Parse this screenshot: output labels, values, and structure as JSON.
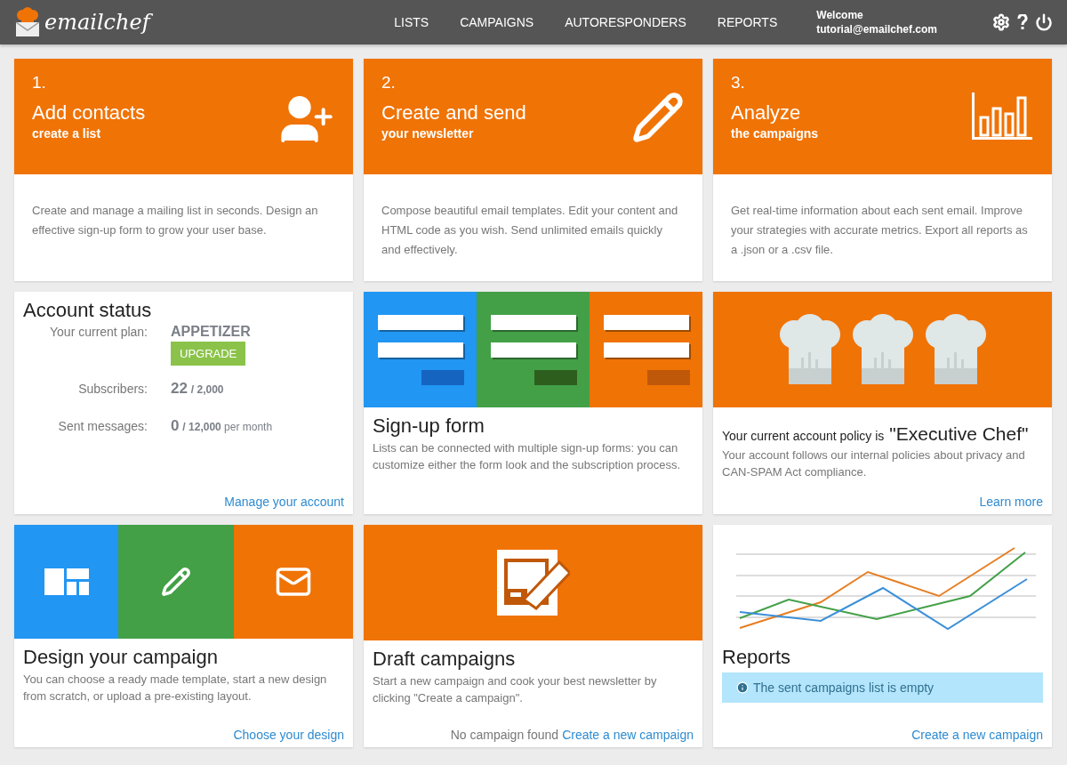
{
  "header": {
    "brand": "emailchef",
    "menu": [
      {
        "label": "LISTS"
      },
      {
        "label": "CAMPAIGNS"
      },
      {
        "label": "AUTORESPONDERS"
      },
      {
        "label": "REPORTS"
      }
    ],
    "welcome": "Welcome",
    "email": "tutorial@emailchef.com"
  },
  "steps": [
    {
      "number": "1.",
      "title": "Add contacts",
      "subtitle": "create a list",
      "description": "Create and manage a mailing list in seconds. Design an effective sign-up form to grow your user base."
    },
    {
      "number": "2.",
      "title": "Create and send",
      "subtitle": "your newsletter",
      "description": "Compose beautiful email templates. Edit your content and HTML code as you wish. Send unlimited emails quickly and effectively."
    },
    {
      "number": "3.",
      "title": "Analyze",
      "subtitle": "the campaigns",
      "description": "Get real-time information about each sent email. Improve your strategies with accurate metrics. Export all reports as a .json or a .csv file."
    }
  ],
  "account": {
    "title": "Account status",
    "plan_label": "Your current plan:",
    "plan": "APPETIZER",
    "upgrade": "UPGRADE",
    "stats": [
      {
        "label": "Subscribers:",
        "value": "22",
        "total": "/ 2,000"
      },
      {
        "label": "Sent messages:",
        "value": "0",
        "total": "/ 12,000",
        "suffix": "per month"
      }
    ],
    "link": "Manage your account"
  },
  "signup": {
    "title": "Sign-up form",
    "description": "Lists can be connected with multiple sign-up forms: you can customize either the form look and the subscription process."
  },
  "policy": {
    "lead": "Your current account policy is",
    "name": "\"Executive Chef\"",
    "description": "Your account follows our internal policies about privacy and CAN-SPAM Act compliance.",
    "link": "Learn more"
  },
  "design": {
    "title": "Design your campaign",
    "description": "You can choose a ready made template, start a new design from scratch, or upload a pre-existing layout.",
    "link": "Choose your design"
  },
  "drafts": {
    "title": "Draft campaigns",
    "description": "Start a new campaign and cook your best newsletter by clicking \"Create a campaign\".",
    "note": "No campaign found",
    "link": "Create a new campaign"
  },
  "reports": {
    "title": "Reports",
    "alert": "The sent campaigns list is empty",
    "link": "Create a new campaign"
  }
}
